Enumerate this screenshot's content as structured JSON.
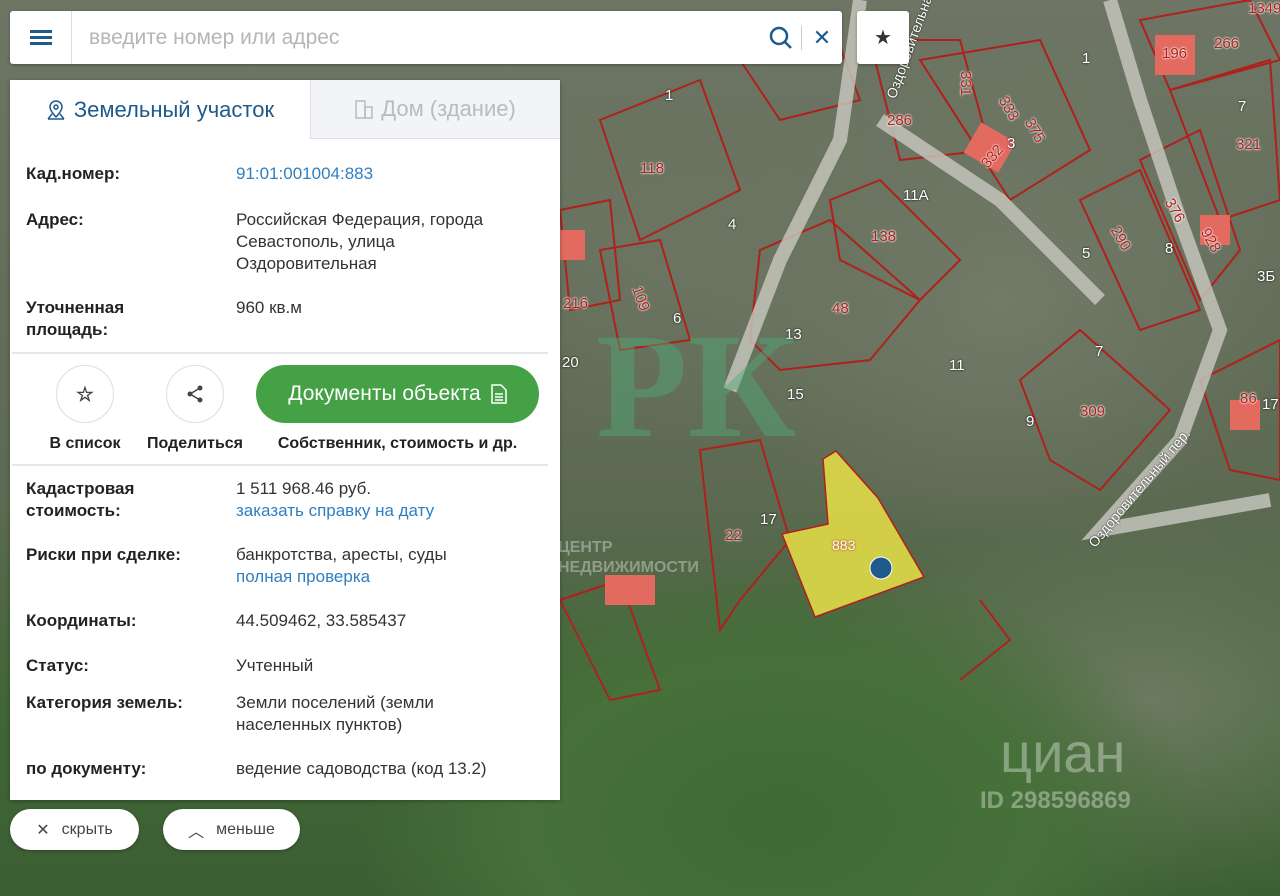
{
  "search": {
    "placeholder": "введите номер или адрес"
  },
  "tabs": [
    {
      "label": "Земельный участок",
      "icon": "map-pin-icon"
    },
    {
      "label": "Дом (здание)",
      "icon": "building-icon"
    }
  ],
  "details_top": [
    {
      "label": "Кад.номер:",
      "value": "91:01:001004:883"
    },
    {
      "label": "Адрес:",
      "value": "Российская Федерация, города Севастополь, улица Оздоровительная"
    },
    {
      "label": "Уточненная площадь:",
      "value": "960 кв.м"
    }
  ],
  "actions": {
    "add_list": "В список",
    "share": "Поделиться",
    "documents_button": "Документы объекта",
    "documents_caption": "Собственник, стоимость и др."
  },
  "details_bottom": [
    {
      "label": "Кадастровая стоимость:",
      "value": "1 511 968.46 руб.",
      "link": "заказать справку на дату"
    },
    {
      "label": "Риски при сделке:",
      "value": "банкротства, аресты, суды",
      "link": "полная проверка"
    },
    {
      "label": "Координаты:",
      "value": "44.509462, 33.585437"
    },
    {
      "label": "Статус:",
      "value": "Учтенный"
    },
    {
      "label": "Категория земель:",
      "value": "Земли поселений (земли населенных пунктов)"
    },
    {
      "label": "по документу:",
      "value": "ведение садоводства (код 13.2)"
    }
  ],
  "bottom": {
    "hide": "скрыть",
    "less": "меньше"
  },
  "map": {
    "selected_parcel": "883",
    "parcels": [
      "118",
      "286",
      "331",
      "333",
      "375",
      "332",
      "196",
      "266",
      "321",
      "138",
      "48",
      "13",
      "290",
      "376",
      "928",
      "216",
      "109",
      "309",
      "86",
      "22",
      "17",
      "11А",
      "3Б",
      "1349"
    ],
    "houses": [
      "1",
      "4",
      "7",
      "3",
      "8",
      "5",
      "11",
      "15",
      "9",
      "7",
      "6",
      "17",
      "1",
      "20"
    ],
    "street": "Оздоровительный пер.",
    "street2": "Оздоровительная ул.",
    "watermark_center": "ЦЕНТР НЕДВИЖИМОСТИ",
    "watermark_cian": "циан",
    "watermark_id": "ID 298596869"
  },
  "colors": {
    "accent": "#1f5a8c",
    "green_button": "#45a145",
    "link": "#2f7fc1",
    "parcel_border": "#b0201c",
    "selected_fill": "#e8e048"
  }
}
